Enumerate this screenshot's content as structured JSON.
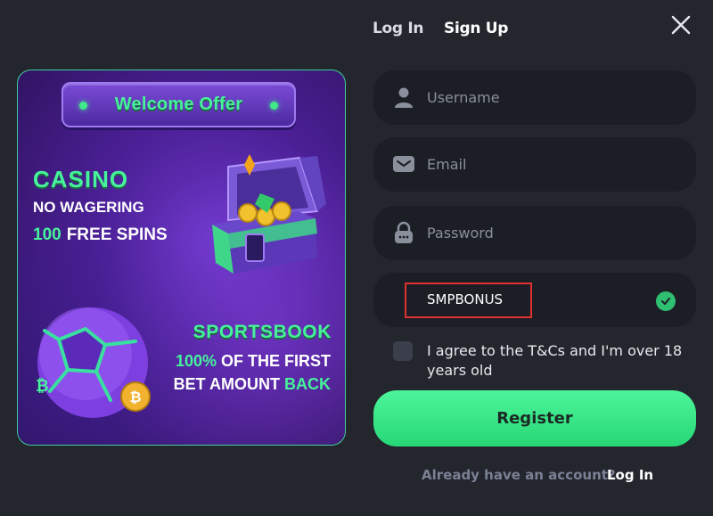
{
  "header": {
    "login_tab": "Log In",
    "signup_tab": "Sign Up"
  },
  "promo": {
    "welcome": "Welcome Offer",
    "casino_title": "CASINO",
    "casino_line1": "NO WAGERING",
    "casino_spins_number": "100",
    "casino_spins_label": "FREE SPINS",
    "sports_title": "SPORTSBOOK",
    "sports_pct": "100%",
    "sports_line1_rest": " OF THE FIRST",
    "sports_line2_main": "BET AMOUNT ",
    "sports_line2_accent": "BACK"
  },
  "form": {
    "username_placeholder": "Username",
    "email_placeholder": "Email",
    "password_placeholder": "Password",
    "promo_code": "SMPBONUS",
    "terms": "I agree to the T&Cs and I'm over 18 years old",
    "register": "Register",
    "already_prompt": "Already have an account?",
    "login_link": "Log In"
  },
  "icons": [
    "close-icon",
    "user-icon",
    "email-icon",
    "lock-icon",
    "check-icon",
    "treasure-chest-icon",
    "soccer-ball-icon",
    "bitcoin-coin-icon"
  ],
  "colors": {
    "background": "#23262d",
    "field_bg": "#1b1e24",
    "accent_green": "#46f29a",
    "promo_purple": "#4a1f94",
    "highlight_red": "#e03030"
  }
}
